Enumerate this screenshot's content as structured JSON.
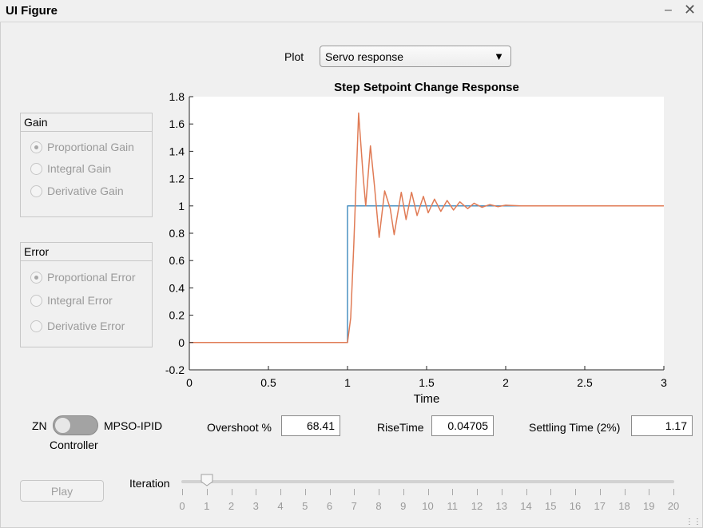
{
  "window": {
    "title": "UI Figure"
  },
  "plot_selector": {
    "label": "Plot",
    "value": "Servo response"
  },
  "gain_panel": {
    "title": "Gain",
    "options": [
      "Proportional Gain",
      "Integral Gain",
      "Derivative Gain"
    ],
    "selected": 0
  },
  "error_panel": {
    "title": "Error",
    "options": [
      "Proportional Error",
      "Integral Error",
      "Derivative Error"
    ],
    "selected": 0
  },
  "controller": {
    "left_label": "ZN",
    "right_label": "MPSO-IPID",
    "caption": "Controller",
    "state": "ZN"
  },
  "metrics": {
    "overshoot_label": "Overshoot %",
    "overshoot_value": "68.41",
    "risetime_label": "RiseTime",
    "risetime_value": "0.04705",
    "settling_label": "Settling Time (2%)",
    "settling_value": "1.17"
  },
  "play": {
    "label": "Play"
  },
  "iteration": {
    "label": "Iteration",
    "value": 1,
    "ticks": [
      "0",
      "1",
      "2",
      "3",
      "4",
      "5",
      "6",
      "7",
      "8",
      "9",
      "10",
      "11",
      "12",
      "13",
      "14",
      "15",
      "16",
      "17",
      "18",
      "19",
      "20"
    ]
  },
  "colors": {
    "setpoint": "#4a90c2",
    "response": "#e07b55"
  },
  "chart_data": {
    "type": "line",
    "title": "Step Setpoint Change Response",
    "xlabel": "Time",
    "ylabel": "",
    "xlim": [
      0,
      3
    ],
    "ylim": [
      -0.2,
      1.8
    ],
    "xticks": [
      "0",
      "0.5",
      "1",
      "1.5",
      "2",
      "2.5",
      "3"
    ],
    "xtick_values": [
      0,
      0.5,
      1,
      1.5,
      2,
      2.5,
      3
    ],
    "yticks": [
      "-0.2",
      "0",
      "0.2",
      "0.4",
      "0.6",
      "0.8",
      "1",
      "1.2",
      "1.4",
      "1.6",
      "1.8"
    ],
    "ytick_values": [
      -0.2,
      0,
      0.2,
      0.4,
      0.6,
      0.8,
      1,
      1.2,
      1.4,
      1.6,
      1.8
    ],
    "grid": false,
    "series": [
      {
        "key": "setpoint",
        "x": [
          0,
          1,
          1,
          3
        ],
        "y": [
          0,
          0,
          1,
          1
        ]
      },
      {
        "key": "response",
        "x": [
          0,
          1.0,
          1.02,
          1.04,
          1.07,
          1.1,
          1.115,
          1.145,
          1.17,
          1.2,
          1.235,
          1.27,
          1.295,
          1.34,
          1.37,
          1.405,
          1.44,
          1.48,
          1.51,
          1.55,
          1.59,
          1.63,
          1.67,
          1.71,
          1.76,
          1.8,
          1.85,
          1.9,
          1.95,
          2.0,
          2.1,
          2.2,
          2.4,
          3.0
        ],
        "y": [
          0,
          0,
          0.18,
          0.72,
          1.68,
          1.2,
          1.0,
          1.44,
          1.15,
          0.77,
          1.11,
          0.98,
          0.79,
          1.1,
          0.9,
          1.1,
          0.93,
          1.07,
          0.95,
          1.05,
          0.96,
          1.04,
          0.97,
          1.03,
          0.98,
          1.02,
          0.99,
          1.01,
          0.995,
          1.005,
          1.0,
          1.0,
          1.0,
          1.0
        ]
      }
    ]
  }
}
